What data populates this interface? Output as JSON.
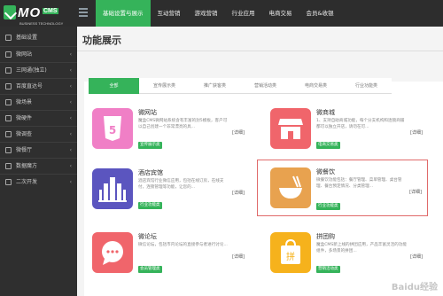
{
  "brand": {
    "name": "MO",
    "badge": "CMS",
    "tagline": "BUSINESS TECHNOLOGY"
  },
  "topnav": [
    {
      "label": "基础设置与展示",
      "active": true
    },
    {
      "label": "互动营销"
    },
    {
      "label": "游戏营销"
    },
    {
      "label": "行业应用"
    },
    {
      "label": "电商交易"
    },
    {
      "label": "会员&收银"
    }
  ],
  "sidebar": [
    {
      "label": "基础设置"
    },
    {
      "label": "微网站"
    },
    {
      "label": "三网通(独立)"
    },
    {
      "label": "百度直达号"
    },
    {
      "label": "微场景"
    },
    {
      "label": "微硬件"
    },
    {
      "label": "微调查"
    },
    {
      "label": "微餐厅"
    },
    {
      "label": "数据魔方"
    },
    {
      "label": "二次开发"
    }
  ],
  "page": {
    "title": "功能展示"
  },
  "tabs": [
    {
      "label": "全部",
      "active": true
    },
    {
      "label": "宣传展示类"
    },
    {
      "label": "推广获客类"
    },
    {
      "label": "营销活动类"
    },
    {
      "label": "电商交易类"
    },
    {
      "label": "行业功能类"
    }
  ],
  "cards": [
    {
      "title": "微网站",
      "desc": "魔盒CMS微网站系统含有丰富的封5模板，客户可以自己创建一个非常漂亮的具...",
      "badge": "宣传展示类",
      "detail": "[详细]",
      "color": "#f07fc6",
      "icon": "html5-icon"
    },
    {
      "title": "微商城",
      "desc": "1、支持自助商城功能，每个分支机构和连锁商铺都可以独立开店，请勿在可...",
      "badge": "电商交易类",
      "detail": "[详细]",
      "color": "#f0656b",
      "icon": "store-icon"
    },
    {
      "title": "酒店宾馆",
      "desc": "酒店宾馆行业微信应用，包括在线订房，在线支付，连锁管理等功能，让您的...",
      "badge": "行业功能类",
      "detail": "[详细]",
      "color": "#5b55bf",
      "icon": "hotel-icon"
    },
    {
      "title": "微餐饮",
      "desc": "微餐饮功能包括：餐厅管理、菜单管理、桌台管理、餐台预定情况、分类管理...",
      "badge": "行业功能类",
      "detail": "[详细]",
      "color": "#e8a24f",
      "icon": "bowl-icon"
    },
    {
      "title": "微论坛",
      "desc": "微信论坛，包括市内论坛的直接参与者进行讨论...",
      "badge": "会员管理类",
      "detail": "[详细]",
      "color": "#f0656b",
      "icon": "chat-icon"
    },
    {
      "title": "拼团购",
      "desc": "魔盒CMS新上线的拼团应用，产品丰富灵活的功能组件，多场景的拼团...",
      "badge": "营销活动类",
      "detail": "[详细]",
      "color": "#f6b21c",
      "icon": "bag-icon"
    }
  ],
  "watermark": "Baidu经验"
}
